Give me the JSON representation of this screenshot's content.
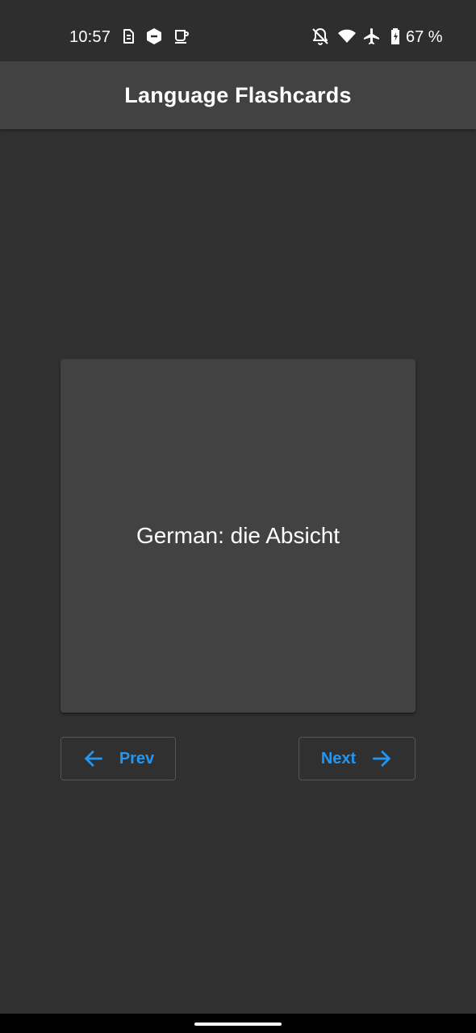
{
  "status_bar": {
    "time": "10:57",
    "battery_percent": "67 %",
    "icons": [
      "sim-icon",
      "app-hexagon-icon",
      "coffee-icon",
      "notifications-off-icon",
      "wifi-icon",
      "airplane-mode-icon",
      "battery-icon"
    ]
  },
  "app_bar": {
    "title": "Language Flashcards"
  },
  "card": {
    "text": "German: die Absicht"
  },
  "buttons": {
    "prev_label": "Prev",
    "next_label": "Next"
  },
  "colors": {
    "background": "#303030",
    "app_bar": "#424242",
    "card": "#424242",
    "accent": "#2196f3"
  }
}
